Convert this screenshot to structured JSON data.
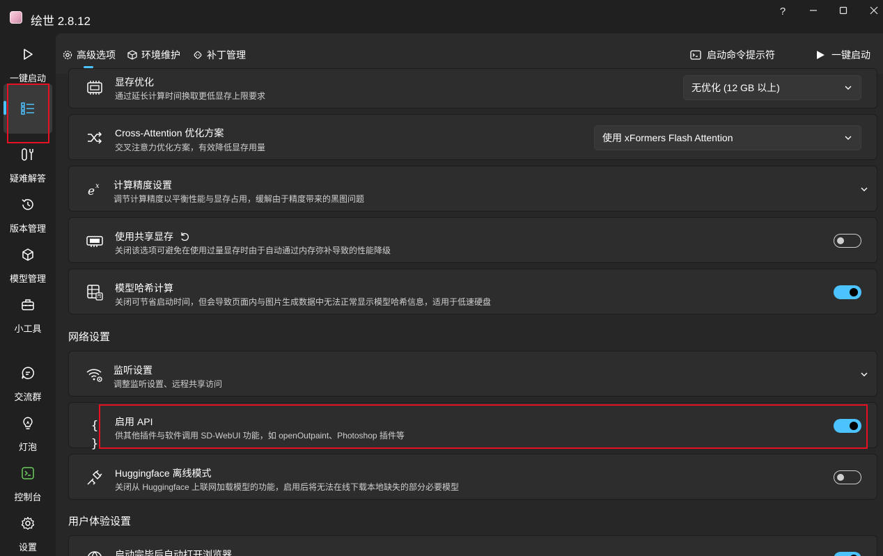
{
  "app": {
    "title": "绘世 2.8.12"
  },
  "window": {
    "help": "?",
    "minimize": "—",
    "maximize": "☐",
    "close": "✕"
  },
  "sidebar": {
    "items": [
      {
        "label": "一键启动",
        "icon": "play-icon"
      },
      {
        "label": "",
        "icon": "list-icon",
        "selected": true
      },
      {
        "label": "疑难解答",
        "icon": "wrench-icon"
      },
      {
        "label": "版本管理",
        "icon": "history-icon"
      },
      {
        "label": "模型管理",
        "icon": "cube-icon"
      },
      {
        "label": "小工具",
        "icon": "toolbox-icon"
      },
      {
        "label": "交流群",
        "icon": "chat-icon"
      },
      {
        "label": "灯泡",
        "icon": "bulb-icon"
      },
      {
        "label": "控制台",
        "icon": "console-icon"
      },
      {
        "label": "设置",
        "icon": "gear-icon"
      }
    ]
  },
  "tabs": [
    {
      "label": "高级选项",
      "icon": "gear-icon",
      "active": true
    },
    {
      "label": "环境维护",
      "icon": "package-icon"
    },
    {
      "label": "补丁管理",
      "icon": "patch-icon"
    }
  ],
  "actions": {
    "console": "启动命令提示符",
    "launch": "一键启动"
  },
  "settings": {
    "vram": {
      "title": "显存优化",
      "desc": "通过延长计算时间换取更低显存上限要求",
      "value": "无优化 (12 GB 以上)"
    },
    "cross_attention": {
      "title": "Cross-Attention 优化方案",
      "desc": "交叉注意力优化方案，有效降低显存用量",
      "value": "使用 xFormers Flash Attention"
    },
    "precision": {
      "title": "计算精度设置",
      "desc": "调节计算精度以平衡性能与显存占用，缓解由于精度带来的黑图问题"
    },
    "shared_vram": {
      "title": "使用共享显存",
      "desc": "关闭该选项可避免在使用过量显存时由于自动通过内存弥补导致的性能降级",
      "enabled": false
    },
    "model_hash": {
      "title": "模型哈希计算",
      "desc": "关闭可节省启动时间，但会导致页面内与图片生成数据中无法正常显示模型哈希信息，适用于低速硬盘",
      "enabled": true
    }
  },
  "network": {
    "section_title": "网络设置",
    "listen": {
      "title": "监听设置",
      "desc": "调整监听设置、远程共享访问"
    },
    "api": {
      "title": "启用 API",
      "desc": "供其他插件与软件调用 SD-WebUI 功能，如 openOutpaint、Photoshop 插件等",
      "enabled": true,
      "icon_text": "{ }"
    },
    "offline": {
      "title": "Huggingface 离线模式",
      "desc": "关闭从 Huggingface 上联网加载模型的功能，启用后将无法在线下载本地缺失的部分必要模型",
      "enabled": false
    }
  },
  "ux": {
    "section_title": "用户体验设置",
    "auto_browser": {
      "title": "启动完毕后自动打开浏览器",
      "enabled": true
    }
  },
  "colors": {
    "accent": "#4cc2ff",
    "highlight": "#e81123"
  }
}
